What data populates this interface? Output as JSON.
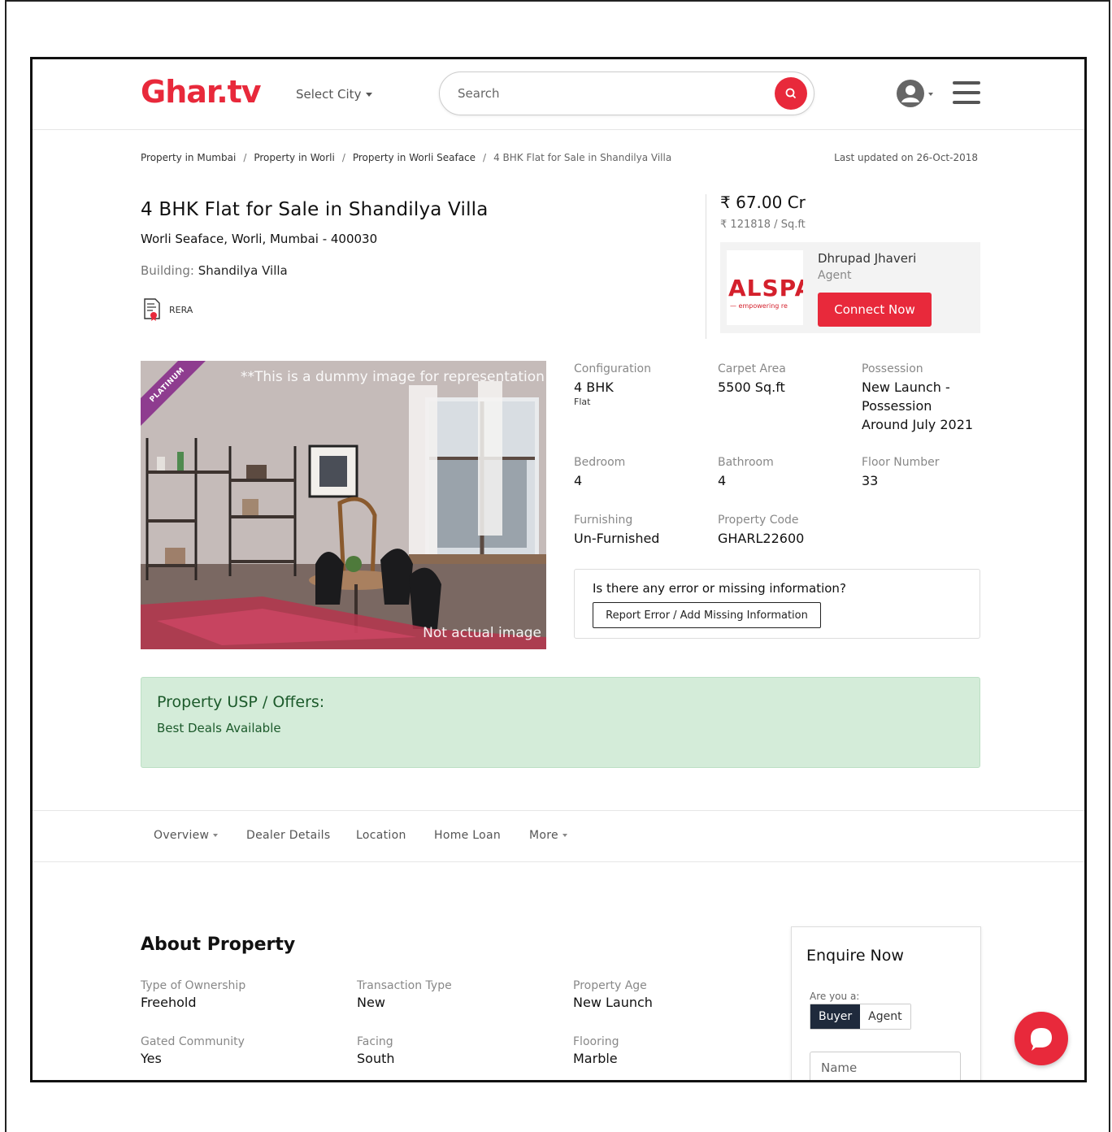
{
  "header": {
    "logo": "Ghar.tv",
    "city_label": "Select City",
    "search_placeholder": "Search"
  },
  "breadcrumb": {
    "items": [
      "Property in Mumbai",
      "Property in Worli",
      "Property in Worli Seaface"
    ],
    "current": "4 BHK Flat for Sale in Shandilya Villa",
    "separator": "/",
    "last_updated": "Last updated on 26-Oct-2018"
  },
  "listing": {
    "title": "4 BHK Flat for Sale in Shandilya Villa",
    "address": "Worli Seaface, Worli, Mumbai - 400030",
    "building_label": "Building:",
    "building_name": "Shandilya Villa",
    "rera": "RERA",
    "price": "67.00 Cr",
    "price_per_sqft": "121818 / Sq.ft",
    "currency_symbol": "₹"
  },
  "agent": {
    "logo_text": "ALSPA",
    "logo_tagline": "— empowering re",
    "name": "Dhrupad Jhaveri",
    "role": "Agent",
    "connect_label": "Connect Now"
  },
  "image": {
    "ribbon": "PLATINUM",
    "watermark_top": "**This is a dummy image for representation",
    "watermark_bottom": "Not actual image"
  },
  "specs": {
    "configuration": {
      "label": "Configuration",
      "value": "4 BHK",
      "sub": "Flat"
    },
    "carpet_area": {
      "label": "Carpet Area",
      "value": "5500 Sq.ft"
    },
    "possession": {
      "label": "Possession",
      "value_lines": [
        "New Launch -",
        "Possession",
        "Around July 2021"
      ]
    },
    "bedroom": {
      "label": "Bedroom",
      "value": "4"
    },
    "bathroom": {
      "label": "Bathroom",
      "value": "4"
    },
    "floor_number": {
      "label": "Floor Number",
      "value": "33"
    },
    "furnishing": {
      "label": "Furnishing",
      "value": "Un-Furnished"
    },
    "property_code": {
      "label": "Property Code",
      "value": "GHARL22600"
    }
  },
  "error_box": {
    "question": "Is there any error or missing information?",
    "button": "Report Error / Add Missing Information"
  },
  "usp": {
    "title": "Property USP / Offers:",
    "text": "Best Deals Available"
  },
  "tabs": [
    "Overview",
    "Dealer Details",
    "Location",
    "Home Loan",
    "More"
  ],
  "about": {
    "title": "About Property",
    "items": [
      {
        "label": "Type of Ownership",
        "value": "Freehold"
      },
      {
        "label": "Transaction Type",
        "value": "New"
      },
      {
        "label": "Property Age",
        "value": "New Launch"
      },
      {
        "label": "Gated Community",
        "value": "Yes"
      },
      {
        "label": "Facing",
        "value": "South"
      },
      {
        "label": "Flooring",
        "value": "Marble"
      }
    ]
  },
  "enquire": {
    "title": "Enquire Now",
    "question": "Are you a:",
    "options": [
      "Buyer",
      "Agent"
    ],
    "selected": "Buyer",
    "name_placeholder": "Name"
  },
  "colors": {
    "brand": "#e8293b",
    "usp_bg": "#d4ecd9",
    "usp_text": "#1c5a2b",
    "toggle_active": "#1f2a3c"
  },
  "icons": {
    "search_button": "search-icon",
    "user": "user-circle-icon",
    "menu": "hamburger-menu-icon",
    "rera": "certificate-document-icon",
    "chat": "chat-bubble-icon"
  }
}
